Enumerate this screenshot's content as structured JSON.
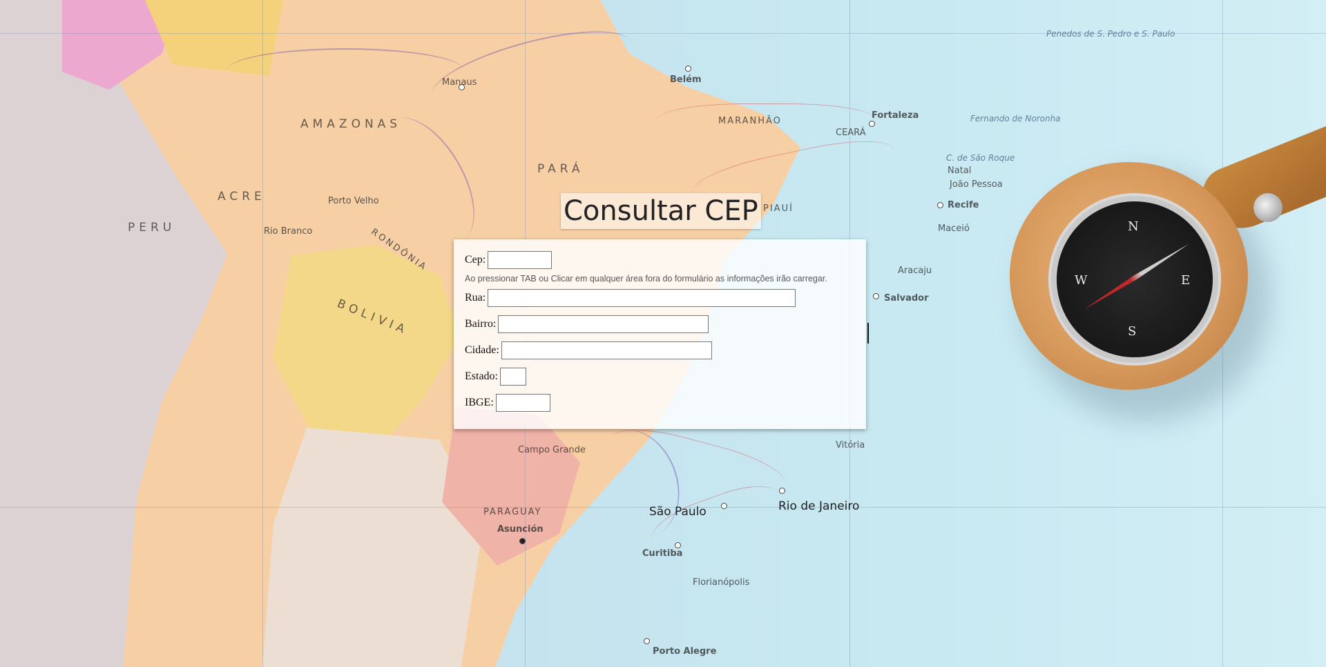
{
  "page": {
    "title": "Consultar CEP"
  },
  "form": {
    "cep_label": "Cep:",
    "hint": "Ao pressionar TAB ou Clicar em qualquer área fora do formulário as informações irão carregar.",
    "rua_label": "Rua:",
    "bairro_label": "Bairro:",
    "cidade_label": "Cidade:",
    "estado_label": "Estado:",
    "ibge_label": "IBGE:",
    "cep_value": "",
    "rua_value": "",
    "bairro_value": "",
    "cidade_value": "",
    "estado_value": "",
    "ibge_value": ""
  },
  "background_map": {
    "labels": [
      "AMAZONAS",
      "PARÁ",
      "ACRE",
      "PERU",
      "BOLIVIA",
      "PARAGUAY",
      "RONDÔNIA",
      "MARANHÃO",
      "PIAUÍ",
      "CEARÁ",
      "São Paulo",
      "Rio de Janeiro",
      "Manaus",
      "Belém",
      "Fortaleza",
      "Recife",
      "Salvador",
      "Curitiba",
      "Porto Alegre",
      "Asunción",
      "Natal",
      "João Pessoa",
      "Maceió",
      "Aracaju",
      "Porto Velho",
      "Rio Branco",
      "Campo Grande",
      "Florianópolis",
      "Vitória",
      "Fernando de Noronha",
      "C. de São Roque",
      "Penedos de S. Pedro e S. Paulo"
    ],
    "compass_letters": [
      "N",
      "E",
      "S",
      "W"
    ],
    "colors": {
      "ocean": "#c5e3ee",
      "brazil": "#f7cfa5",
      "bolivia": "#f4d889",
      "paraguay": "#f0b3a8",
      "peru": "#dcd2d3"
    }
  }
}
